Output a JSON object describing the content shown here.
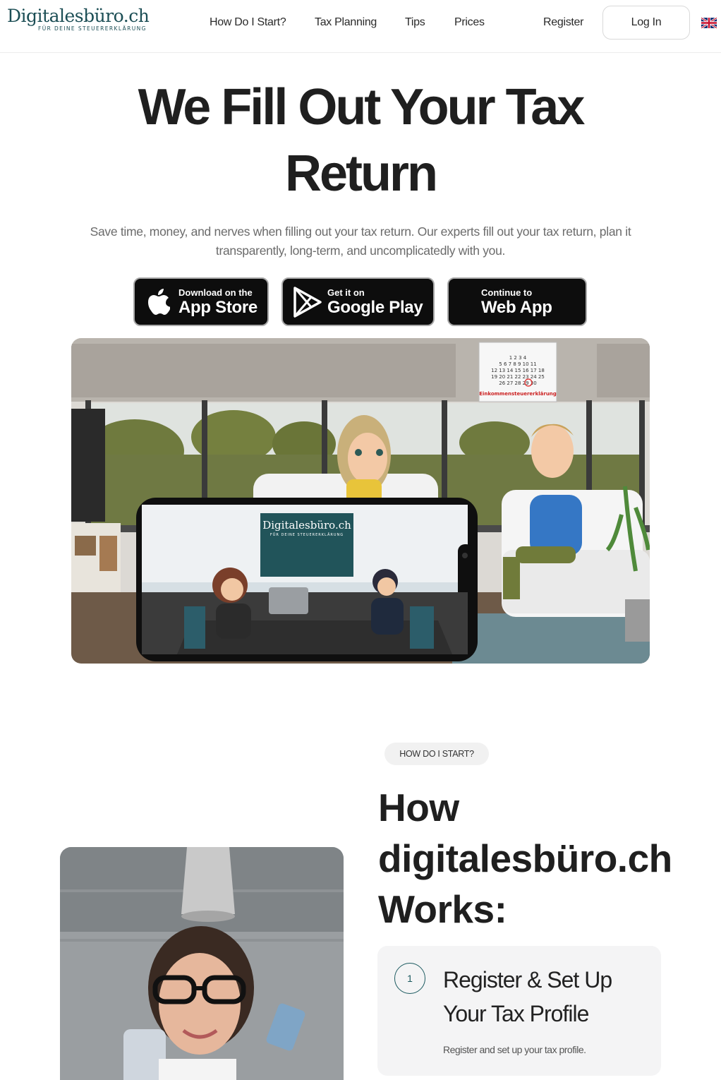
{
  "header": {
    "logo_text": "Digitalesbüro.ch",
    "logo_tagline": "FÜR DEINE STEUERERKLÄRUNG",
    "nav": [
      {
        "label": "How Do I Start?"
      },
      {
        "label": "Tax Planning"
      },
      {
        "label": "Tips"
      },
      {
        "label": "Prices"
      }
    ],
    "register_label": "Register",
    "login_label": "Log In",
    "language_icon": "uk-flag-icon"
  },
  "hero": {
    "title_line1": "We Fill Out Your Tax",
    "title_line2": "Return",
    "subtitle": "Save time, money, and nerves when filling out your tax return. Our experts fill out your tax return, plan it transparently, long-term, and uncomplicatedly with you.",
    "buttons": {
      "app_store": {
        "small": "Download on the",
        "big": "App Store",
        "icon": "apple-icon"
      },
      "google_play": {
        "small": "Get it on",
        "big": "Google Play",
        "icon": "google-play-icon"
      },
      "web_app": {
        "small": "Continue to",
        "big": "Web App"
      }
    }
  },
  "illustration": {
    "calendar_label": "Einkommensteuererklärung",
    "calendar_rows": [
      "1  2  3  4",
      "5  6  7  8  9 10 11",
      "12 13 14 15 16 17 18",
      "19 20 21 22 23 24 25",
      "26 27 28 29 30"
    ],
    "phone_logo": "Digitalesbüro.ch",
    "phone_tagline": "FÜR DEINE STEUERERKLÄRUNG"
  },
  "how": {
    "pill": "HOW DO I START?",
    "title_line1": "How",
    "title_line2": "digitalesbüro.ch",
    "title_line3": "Works:",
    "steps": [
      {
        "number": "1",
        "title": "Register & Set Up Your Tax Profile",
        "description": "Register and set up your tax profile."
      }
    ]
  },
  "colors": {
    "brand": "#1c4e55",
    "button_dark": "#0d0d0d",
    "card_bg": "#f4f4f5"
  }
}
